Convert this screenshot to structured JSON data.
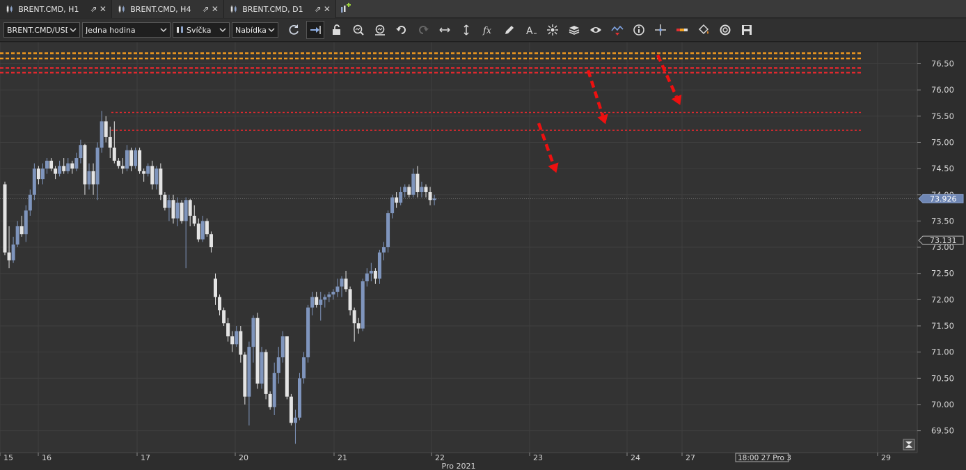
{
  "tabs": [
    {
      "label": "BRENT.CMD, H1",
      "active": true
    },
    {
      "label": "BRENT.CMD, H4",
      "active": false
    },
    {
      "label": "BRENT.CMD, D1",
      "active": false
    }
  ],
  "toolbar": {
    "instrument": "BRENT.CMD/USD",
    "period": "Jedna hodina",
    "chart_type": "Svíčka",
    "price_side": "Nabídka",
    "tools": [
      "refresh-icon",
      "shift-chart-icon",
      "unlock-icon",
      "zoom-in-icon",
      "zoom-out-icon",
      "undo-icon",
      "redo-icon",
      "horizontal-arrows-icon",
      "vertical-arrows-icon",
      "fx-indicator-icon",
      "pencil-icon",
      "text-tool-icon",
      "crosshair-star-icon",
      "layers-icon",
      "eye-icon",
      "chart-alert-icon",
      "info-icon",
      "cursor-cross-icon",
      "color-bar-icon",
      "paint-bucket-icon",
      "cycle-icon",
      "save-icon"
    ]
  },
  "colors": {
    "bull_body": "#7f95bd",
    "bear_body": "#e4e4e4",
    "grid": "#3f3f3f",
    "orange_line": "#f29a1e",
    "red_line": "#e0282e",
    "arrow": "#ee1010",
    "current_price": "#7f95bd"
  },
  "chart_data": {
    "type": "candlestick",
    "symbol": "BRENT.CMD",
    "timeframe": "H1",
    "ylim": [
      69.2,
      77.0
    ],
    "y_ticks": [
      "76.50",
      "76.00",
      "75.50",
      "75.00",
      "74.50",
      "74.00",
      "73.50",
      "73.00",
      "72.50",
      "72.00",
      "71.50",
      "71.00",
      "70.50",
      "70.00",
      "69.50"
    ],
    "x_ticks": [
      "15",
      "16",
      "17",
      "20",
      "21",
      "22",
      "23",
      "24",
      "27",
      "29"
    ],
    "x_caption": "Pro 2021",
    "crosshair_time_label": "18:00 27 Pro 3",
    "current_price_label": "73.926",
    "current_price": 73.926,
    "marker_price_label": "73.131",
    "marker_price": 73.131,
    "horizontal_lines": [
      {
        "price": 76.7,
        "color": "orange"
      },
      {
        "price": 76.6,
        "color": "orange"
      },
      {
        "price": 76.42,
        "color": "red"
      },
      {
        "price": 76.33,
        "color": "red"
      },
      {
        "price": 75.57,
        "color": "red"
      },
      {
        "price": 75.23,
        "color": "red"
      }
    ],
    "candles": [
      [
        74.2,
        74.25,
        72.85,
        72.9
      ],
      [
        72.9,
        73.4,
        72.6,
        72.75
      ],
      [
        72.75,
        73.2,
        72.7,
        73.05
      ],
      [
        73.05,
        73.5,
        73.0,
        73.4
      ],
      [
        73.4,
        73.6,
        73.2,
        73.25
      ],
      [
        73.25,
        73.8,
        73.1,
        73.7
      ],
      [
        73.7,
        74.1,
        73.6,
        74.0
      ],
      [
        74.0,
        74.6,
        73.9,
        74.5
      ],
      [
        74.5,
        74.55,
        74.2,
        74.3
      ],
      [
        74.3,
        74.6,
        74.2,
        74.5
      ],
      [
        74.5,
        74.7,
        74.4,
        74.65
      ],
      [
        74.65,
        74.7,
        74.45,
        74.5
      ],
      [
        74.5,
        74.55,
        74.3,
        74.4
      ],
      [
        74.4,
        74.65,
        74.35,
        74.55
      ],
      [
        74.55,
        74.7,
        74.4,
        74.45
      ],
      [
        74.45,
        74.7,
        74.4,
        74.6
      ],
      [
        74.6,
        74.65,
        74.4,
        74.5
      ],
      [
        74.5,
        74.8,
        74.45,
        74.7
      ],
      [
        74.7,
        75.05,
        74.6,
        74.95
      ],
      [
        74.95,
        74.97,
        74.0,
        74.2
      ],
      [
        74.2,
        74.6,
        74.1,
        74.45
      ],
      [
        74.45,
        74.6,
        74.0,
        74.2
      ],
      [
        74.2,
        75.0,
        73.9,
        74.9
      ],
      [
        74.9,
        75.6,
        74.8,
        75.4
      ],
      [
        75.4,
        75.5,
        75.0,
        75.1
      ],
      [
        75.1,
        75.3,
        74.7,
        74.9
      ],
      [
        74.9,
        75.4,
        74.6,
        74.65
      ],
      [
        74.65,
        74.7,
        74.5,
        74.55
      ],
      [
        74.55,
        74.7,
        74.4,
        74.5
      ],
      [
        74.5,
        74.95,
        74.45,
        74.85
      ],
      [
        74.85,
        74.9,
        74.45,
        74.55
      ],
      [
        74.55,
        74.9,
        74.5,
        74.85
      ],
      [
        74.85,
        74.9,
        74.4,
        74.45
      ],
      [
        74.45,
        74.5,
        74.25,
        74.4
      ],
      [
        74.4,
        74.6,
        74.35,
        74.55
      ],
      [
        74.55,
        74.65,
        74.1,
        74.2
      ],
      [
        74.2,
        74.55,
        74.1,
        74.5
      ],
      [
        74.5,
        74.6,
        73.9,
        74.0
      ],
      [
        74.0,
        74.05,
        73.7,
        73.75
      ],
      [
        73.75,
        74.0,
        73.5,
        73.9
      ],
      [
        73.9,
        74.0,
        73.45,
        73.55
      ],
      [
        73.55,
        73.95,
        73.4,
        73.85
      ],
      [
        73.85,
        73.9,
        73.45,
        73.5
      ],
      [
        73.5,
        73.95,
        72.6,
        73.9
      ],
      [
        73.9,
        73.92,
        73.4,
        73.6
      ],
      [
        73.6,
        73.8,
        73.4,
        73.45
      ],
      [
        73.45,
        73.55,
        73.1,
        73.15
      ],
      [
        73.15,
        73.6,
        73.1,
        73.5
      ],
      [
        73.5,
        73.55,
        73.2,
        73.25
      ],
      [
        73.25,
        73.3,
        72.9,
        73.0
      ],
      [
        72.4,
        72.5,
        71.9,
        72.05
      ],
      [
        72.05,
        72.1,
        71.7,
        71.8
      ],
      [
        71.8,
        71.85,
        71.5,
        71.55
      ],
      [
        71.55,
        71.65,
        71.2,
        71.3
      ],
      [
        71.3,
        71.4,
        71.0,
        71.15
      ],
      [
        71.15,
        71.5,
        71.1,
        71.4
      ],
      [
        71.4,
        71.5,
        70.8,
        70.95
      ],
      [
        70.95,
        71.0,
        70.0,
        70.15
      ],
      [
        70.15,
        71.2,
        69.6,
        71.1
      ],
      [
        71.1,
        71.7,
        70.8,
        71.65
      ],
      [
        71.65,
        71.75,
        70.3,
        70.4
      ],
      [
        70.4,
        71.1,
        70.3,
        71.0
      ],
      [
        71.0,
        71.05,
        70.1,
        70.2
      ],
      [
        70.2,
        70.25,
        69.9,
        69.95
      ],
      [
        69.95,
        70.8,
        69.8,
        70.6
      ],
      [
        70.6,
        71.1,
        70.4,
        70.9
      ],
      [
        70.9,
        71.4,
        70.8,
        71.3
      ],
      [
        71.3,
        71.3,
        70.1,
        70.15
      ],
      [
        70.15,
        70.2,
        69.6,
        69.65
      ],
      [
        69.65,
        69.9,
        69.25,
        69.75
      ],
      [
        69.75,
        70.6,
        69.7,
        70.5
      ],
      [
        70.5,
        71.0,
        70.4,
        70.9
      ],
      [
        70.9,
        71.9,
        70.8,
        71.85
      ],
      [
        71.85,
        72.15,
        71.7,
        72.05
      ],
      [
        72.05,
        72.15,
        71.85,
        71.9
      ],
      [
        71.9,
        72.15,
        71.6,
        72.0
      ],
      [
        72.0,
        72.1,
        71.85,
        72.05
      ],
      [
        72.05,
        72.15,
        71.95,
        72.1
      ],
      [
        72.1,
        72.2,
        72.0,
        72.15
      ],
      [
        72.15,
        72.4,
        72.05,
        72.25
      ],
      [
        72.25,
        72.45,
        72.05,
        72.4
      ],
      [
        72.4,
        72.55,
        72.15,
        72.2
      ],
      [
        72.2,
        72.25,
        71.7,
        71.8
      ],
      [
        71.8,
        71.85,
        71.2,
        71.55
      ],
      [
        71.55,
        71.65,
        71.35,
        71.45
      ],
      [
        71.45,
        72.4,
        71.4,
        72.35
      ],
      [
        72.35,
        72.6,
        72.25,
        72.5
      ],
      [
        72.5,
        72.7,
        72.35,
        72.55
      ],
      [
        72.55,
        72.6,
        72.3,
        72.4
      ],
      [
        72.4,
        72.95,
        72.3,
        72.9
      ],
      [
        72.9,
        73.1,
        72.75,
        73.0
      ],
      [
        73.0,
        73.7,
        72.9,
        73.65
      ],
      [
        73.65,
        74.0,
        73.55,
        73.95
      ],
      [
        73.95,
        74.05,
        73.75,
        73.85
      ],
      [
        73.85,
        74.15,
        73.8,
        74.05
      ],
      [
        74.05,
        74.2,
        73.95,
        74.15
      ],
      [
        74.15,
        74.2,
        73.95,
        74.0
      ],
      [
        74.0,
        74.5,
        73.95,
        74.4
      ],
      [
        74.4,
        74.55,
        73.95,
        74.05
      ],
      [
        74.05,
        74.25,
        73.95,
        74.15
      ],
      [
        74.15,
        74.2,
        73.95,
        74.05
      ],
      [
        74.05,
        74.15,
        73.8,
        73.9
      ],
      [
        73.9,
        74.0,
        73.8,
        73.93
      ]
    ]
  }
}
